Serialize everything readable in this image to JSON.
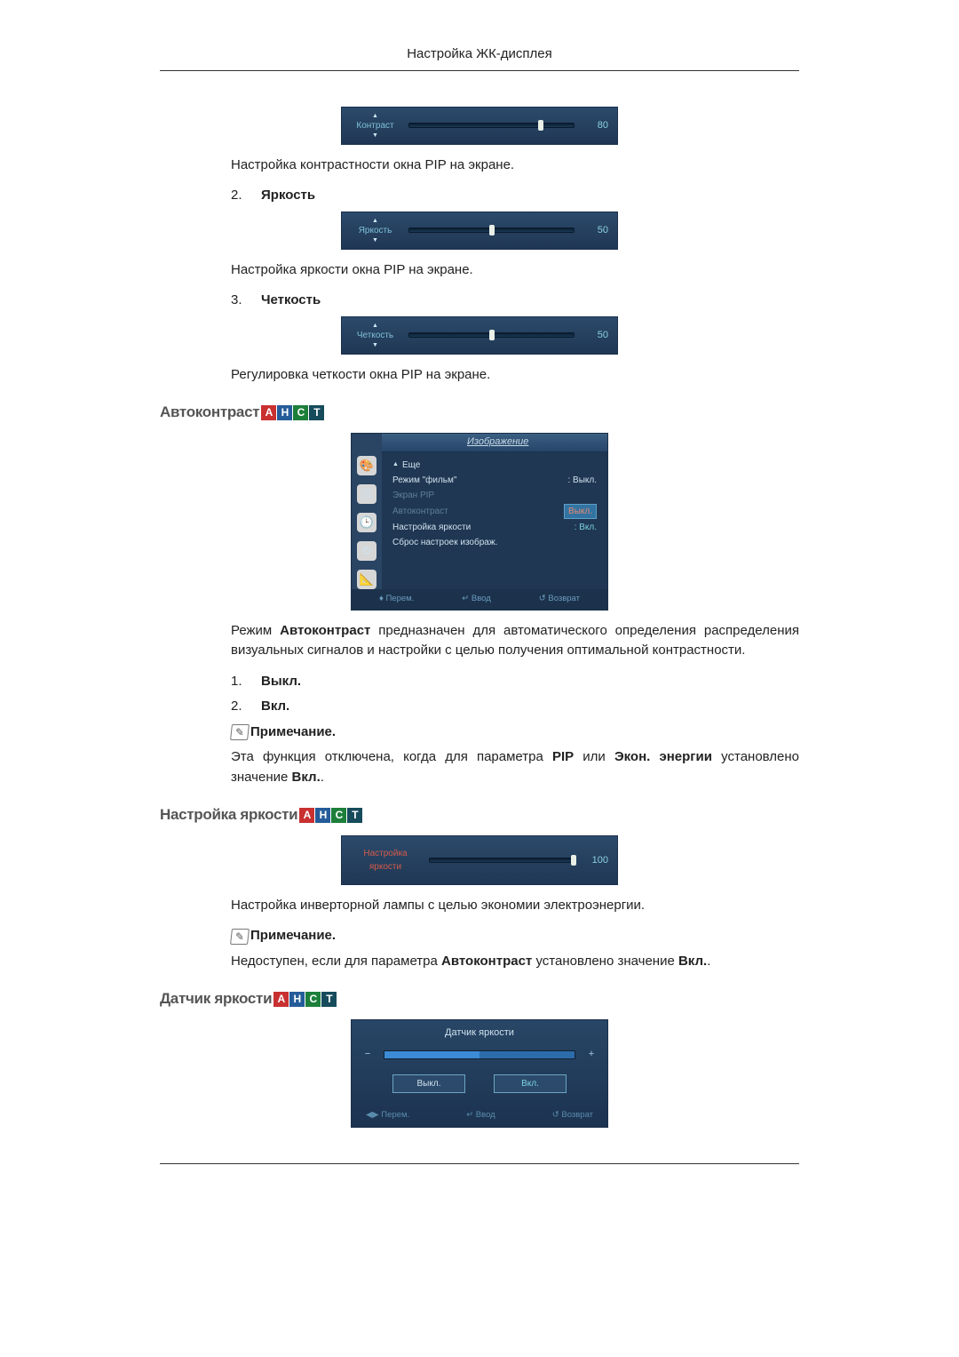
{
  "header": {
    "title": "Настройка ЖК-дисплея"
  },
  "slider_contrast": {
    "label": "Контраст",
    "value": "80",
    "thumb_percent": 80
  },
  "text_contrast_desc": "Настройка контрастности окна PIP на экране.",
  "list_brightness": {
    "num": "2.",
    "label": "Яркость"
  },
  "slider_brightness": {
    "label": "Яркость",
    "value": "50",
    "thumb_percent": 50
  },
  "text_brightness_desc": "Настройка яркости окна PIP на экране.",
  "list_sharpness": {
    "num": "3.",
    "label": "Четкость"
  },
  "slider_sharpness": {
    "label": "Четкость",
    "value": "50",
    "thumb_percent": 50
  },
  "text_sharpness_desc": "Регулировка четкости окна PIP на экране.",
  "heading_autocontrast": "Автоконтраст",
  "badges": {
    "a": "A",
    "h": "H",
    "c": "C",
    "t": "T"
  },
  "osd": {
    "title": "Изображение",
    "tri": "▲",
    "items": {
      "more": "Еще",
      "movie_label": "Режим \"фильм\"",
      "movie_value": ": Выкл.",
      "pip_screen": "Экран PIP",
      "autocontrast_label": "Автоконтраст",
      "autocontrast_value": "Выкл.",
      "brightness_adj_label": "Настройка яркости",
      "brightness_adj_value": "Вкл.",
      "reset": "Сброс настроек изображ."
    },
    "footer": {
      "move": "Перем.",
      "enter": "Ввод",
      "return": "Возврат"
    }
  },
  "text_ac_para_1": "Режим ",
  "text_ac_para_b": "Автоконтраст",
  "text_ac_para_2": " предназначен для автоматического определения распределения визуальных сигналов и настройки с целью получения оптимальной контрастности.",
  "list_off": {
    "num": "1.",
    "label": "Выкл."
  },
  "list_on": {
    "num": "2.",
    "label": "Вкл."
  },
  "note_label": "Примечание.",
  "note_icon_char": "✎",
  "text_note_ac_1": "Эта функция отключена, когда для параметра ",
  "text_note_ac_b1": "PIP",
  "text_note_ac_2": " или ",
  "text_note_ac_b2": "Экон. энергии",
  "text_note_ac_3": " установлено значение ",
  "text_note_ac_b3": "Вкл.",
  "text_note_ac_4": ".",
  "heading_brightness_adj": "Настройка яркости",
  "slider_brightness_adj": {
    "label": "Настройка яркости",
    "value": "100",
    "thumb_percent": 100
  },
  "text_ba_desc": "Настройка инверторной лампы с целью экономии электроэнергии.",
  "text_note_ba_1": "Недоступен, если для параметра ",
  "text_note_ba_b": "Автоконтраст",
  "text_note_ba_2": " установлено значение ",
  "text_note_ba_b2": "Вкл.",
  "text_note_ba_3": ".",
  "heading_sensor": "Датчик яркости",
  "sensor": {
    "title": "Датчик яркости",
    "off": "Выкл.",
    "on": "Вкл.",
    "footer": {
      "move": "Перем.",
      "enter": "Ввод",
      "return": "Возврат"
    }
  }
}
